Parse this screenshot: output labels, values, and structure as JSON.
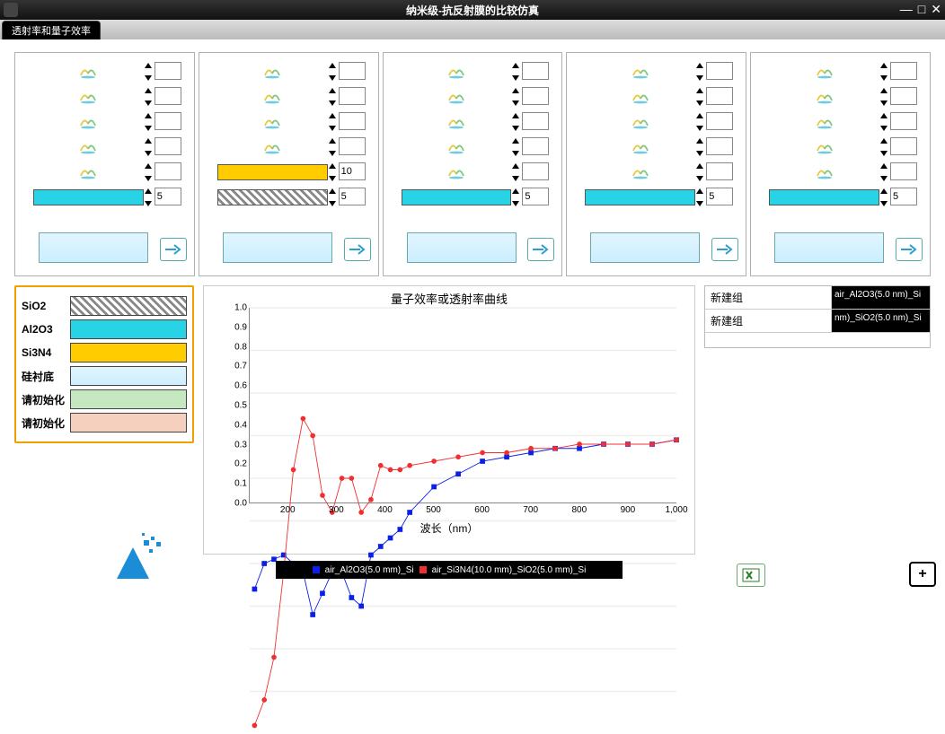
{
  "window": {
    "title": "纳米级-抗反射膜的比较仿真"
  },
  "tab": {
    "label": "透射率和量子效率"
  },
  "stacks": [
    {
      "layers": [
        null,
        null,
        null,
        null,
        null,
        {
          "material": "al2o3",
          "thickness": "5"
        }
      ]
    },
    {
      "layers": [
        null,
        null,
        null,
        null,
        {
          "material": "si3n4",
          "thickness": "10"
        },
        {
          "material": "sio2",
          "thickness": "5"
        }
      ]
    },
    {
      "layers": [
        null,
        null,
        null,
        null,
        null,
        {
          "material": "al2o3",
          "thickness": "5"
        }
      ]
    },
    {
      "layers": [
        null,
        null,
        null,
        null,
        null,
        {
          "material": "al2o3",
          "thickness": "5"
        }
      ]
    },
    {
      "layers": [
        null,
        null,
        null,
        null,
        null,
        {
          "material": "al2o3",
          "thickness": "5"
        }
      ]
    }
  ],
  "legend": {
    "sio2": "SiO2",
    "al2o3": "Al2O3",
    "si3n4": "Si3N4",
    "substrate": "硅衬底",
    "init1": "请初始化",
    "init2": "请初始化"
  },
  "chart_data": {
    "type": "line",
    "title": "量子效率或透射率曲线",
    "xlabel": "波长（nm）",
    "ylabel": "",
    "xlim": [
      120,
      1000
    ],
    "ylim": [
      0,
      1.0
    ],
    "x": [
      130,
      150,
      170,
      190,
      210,
      230,
      250,
      270,
      290,
      310,
      330,
      350,
      370,
      390,
      410,
      430,
      450,
      500,
      550,
      600,
      650,
      700,
      750,
      800,
      850,
      900,
      950,
      1000
    ],
    "series": [
      {
        "name": "air_Al2O3(5.0 nm)_Si",
        "color": "#0a20e6",
        "marker": "square",
        "values": [
          0.34,
          0.4,
          0.41,
          0.42,
          0.4,
          0.38,
          0.28,
          0.33,
          0.38,
          0.38,
          0.32,
          0.3,
          0.42,
          0.44,
          0.46,
          0.48,
          0.52,
          0.58,
          0.61,
          0.64,
          0.65,
          0.66,
          0.67,
          0.67,
          0.68,
          0.68,
          0.68,
          0.69
        ]
      },
      {
        "name": "air_Si3N4(10.0 nm)_SiO2(5.0 nm)_Si",
        "color": "#f03030",
        "marker": "circle",
        "values": [
          0.02,
          0.08,
          0.18,
          0.38,
          0.62,
          0.74,
          0.7,
          0.56,
          0.52,
          0.6,
          0.6,
          0.52,
          0.55,
          0.63,
          0.62,
          0.62,
          0.63,
          0.64,
          0.65,
          0.66,
          0.66,
          0.67,
          0.67,
          0.68,
          0.68,
          0.68,
          0.68,
          0.69
        ]
      }
    ]
  },
  "groups": [
    {
      "label": "新建组",
      "data": "air_Al2O3(5.0 nm)_Si"
    },
    {
      "label": "新建组",
      "data": "nm)_SiO2(5.0 nm)_Si"
    }
  ],
  "legend_strip": {
    "a": "air_Al2O3(5.0 mm)_Si",
    "b": "air_Si3N4(10.0 mm)_SiO2(5.0 mm)_Si"
  }
}
